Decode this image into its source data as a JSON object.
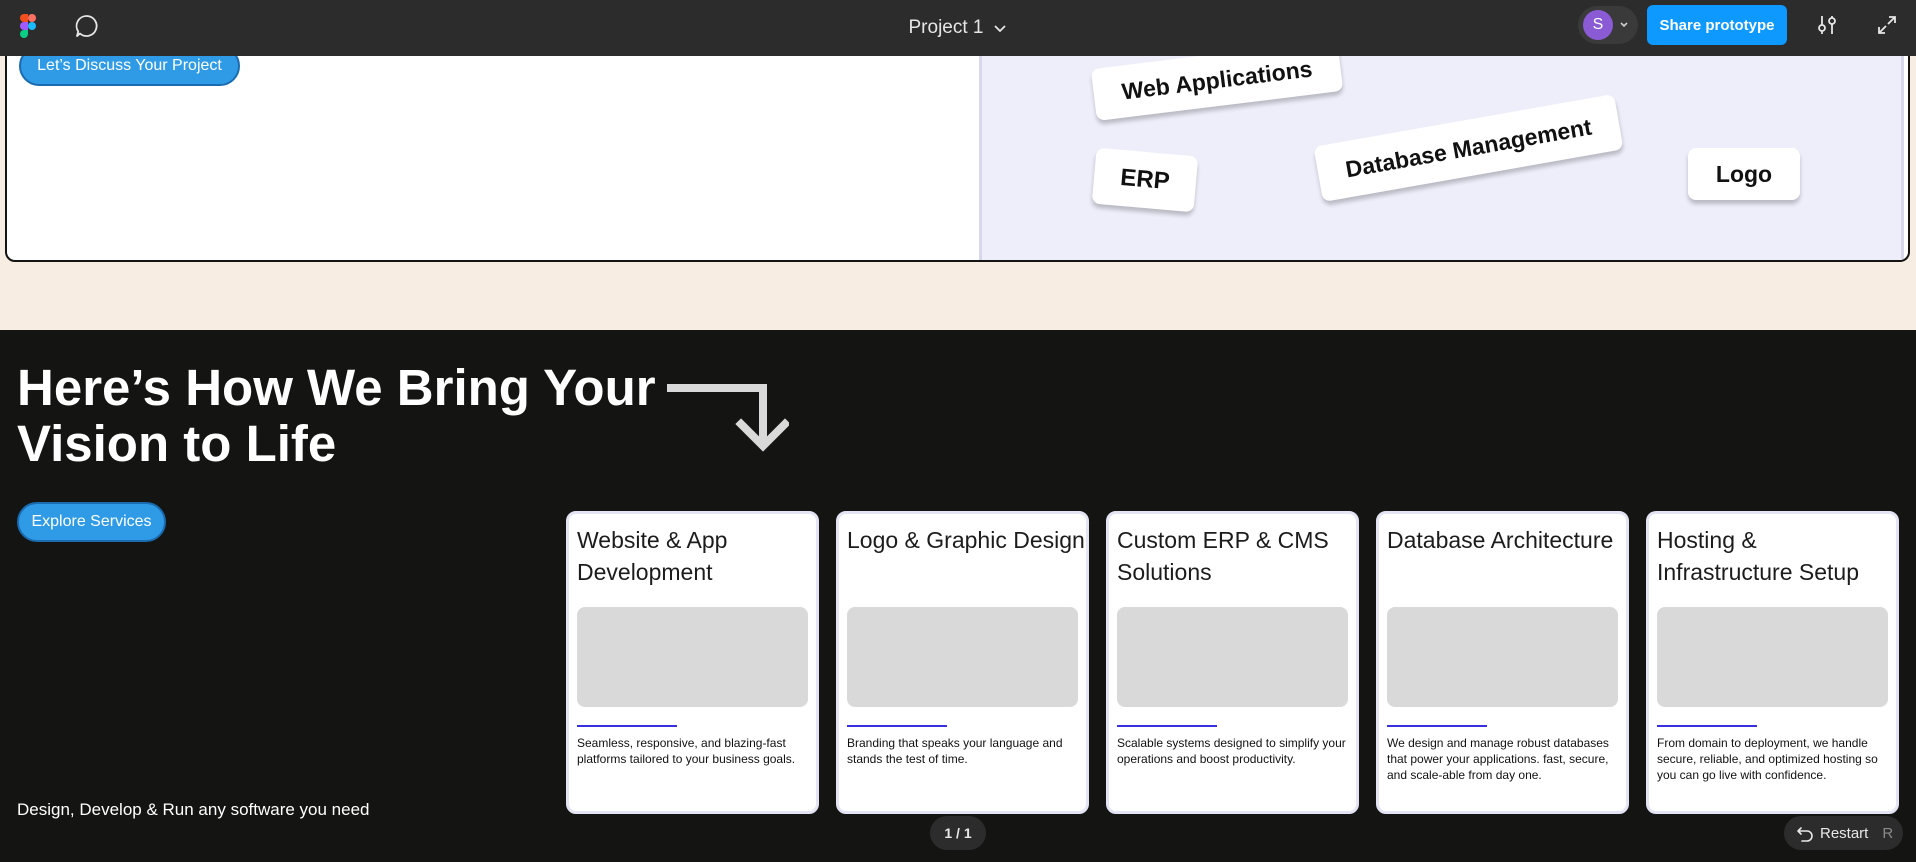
{
  "toolbar": {
    "project_title": "Project 1",
    "avatar_initial": "S",
    "share_label": "Share prototype",
    "icons": [
      "figma-logo-icon",
      "comment-icon",
      "chevron-down-icon",
      "settings-sliders-icon",
      "expand-icon"
    ]
  },
  "hero": {
    "discuss_label": "Let’s Discuss Your Project",
    "tags": {
      "web": "Web Applications",
      "erp": "ERP",
      "db": "Database Management",
      "logo": "Logo"
    }
  },
  "services_section": {
    "heading_line1": "Here’s How We Bring Your",
    "heading_line2": "Vision to Life",
    "explore_label": "Explore Services",
    "tagline": "Design, Develop & Run any software you need",
    "cards": [
      {
        "title": "Website & App Development",
        "desc": "Seamless, responsive, and blazing-fast platforms tailored to your business goals."
      },
      {
        "title": "Logo & Graphic Design",
        "desc": "Branding that speaks your language and stands the test of time."
      },
      {
        "title": "Custom ERP & CMS Solutions",
        "desc": "Scalable systems designed to simplify your operations and boost productivity."
      },
      {
        "title": "Database Architecture",
        "desc": "We design and manage robust databases that power your applications. fast, secure, and scale-able from day one."
      },
      {
        "title": "Hosting & Infrastructure Setup",
        "desc": "From domain to deployment, we handle secure, reliable, and optimized hosting so you can go live with confidence."
      }
    ]
  },
  "player": {
    "page_indicator": "1 / 1",
    "restart_label": "Restart",
    "restart_key": "R"
  },
  "colors": {
    "accent_blue": "#0d99ff",
    "button_blue": "#2f9be6",
    "dark_bg": "#141412",
    "cream_bg": "#f7ede2",
    "panel_lavender": "#eeeefb",
    "card_underline": "#3a2fe0"
  }
}
